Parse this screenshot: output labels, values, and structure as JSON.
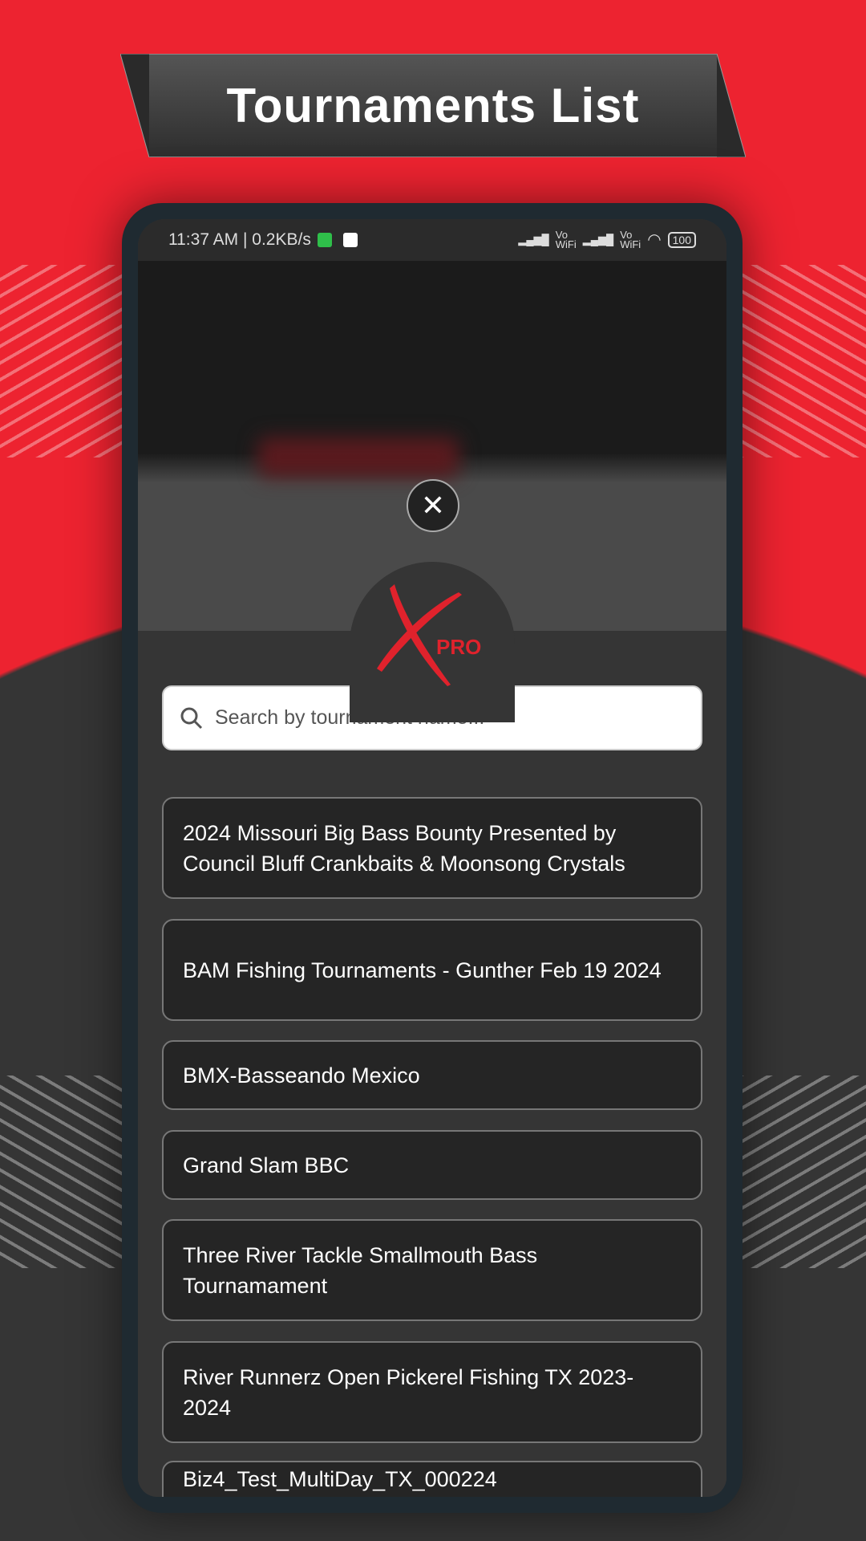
{
  "banner": {
    "title": "Tournaments List"
  },
  "status_bar": {
    "time": "11:37 AM | 0.2KB/s",
    "net1": "Vo\nWiFi",
    "net2": "Vo\nWiFi",
    "battery": "100"
  },
  "logo": {
    "text": "PRO"
  },
  "search": {
    "placeholder": "Search by tournament name...",
    "value": ""
  },
  "tournaments": [
    "2024 Missouri Big Bass Bounty Presented by Council Bluff Crankbaits & Moonsong Crystals",
    "BAM Fishing Tournaments - Gunther Feb 19 2024",
    "BMX-Basseando Mexico",
    "Grand Slam BBC",
    "Three River Tackle Smallmouth Bass Tournamament",
    "River Runnerz Open Pickerel Fishing TX 2023-2024",
    "Biz4_Test_MultiDay_TX_000224"
  ],
  "colors": {
    "brand_red": "#ed2330",
    "dark": "#353535"
  }
}
